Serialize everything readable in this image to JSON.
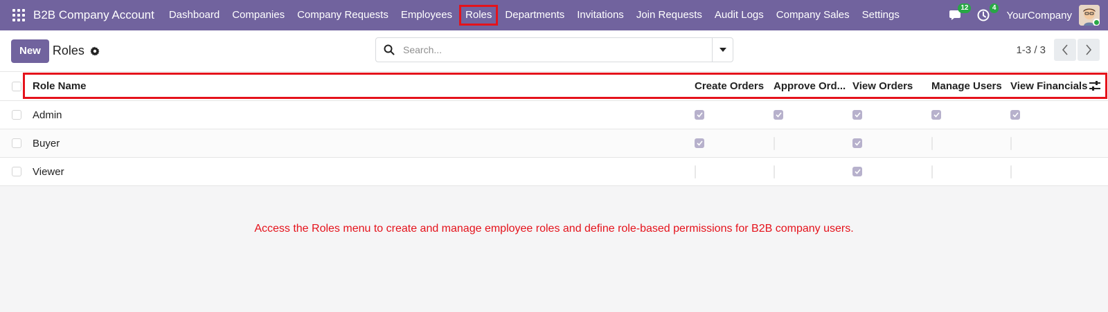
{
  "topbar": {
    "brand": "B2B Company Account",
    "menu": [
      "Dashboard",
      "Companies",
      "Company Requests",
      "Employees",
      "Roles",
      "Departments",
      "Invitations",
      "Join Requests",
      "Audit Logs",
      "Company Sales",
      "Settings"
    ],
    "active_menu": "Roles",
    "messages_badge": "12",
    "activity_badge": "4",
    "company_name": "YourCompany",
    "accent_color": "#71639e"
  },
  "control": {
    "new_label": "New",
    "title": "Roles",
    "search_placeholder": "Search...",
    "pager": "1-3 / 3"
  },
  "table": {
    "columns": [
      "Role Name",
      "Create Orders",
      "Approve Ord...",
      "View Orders",
      "Manage Users",
      "View Financials"
    ],
    "rows": [
      {
        "name": "Admin",
        "perms": [
          true,
          true,
          true,
          true,
          true
        ]
      },
      {
        "name": "Buyer",
        "perms": [
          true,
          false,
          true,
          false,
          false
        ]
      },
      {
        "name": "Viewer",
        "perms": [
          false,
          false,
          true,
          false,
          false
        ]
      }
    ]
  },
  "annotation": {
    "text": "Access the Roles menu to create and manage employee roles and define role-based permissions for B2B company users.",
    "color": "#e5121b"
  }
}
